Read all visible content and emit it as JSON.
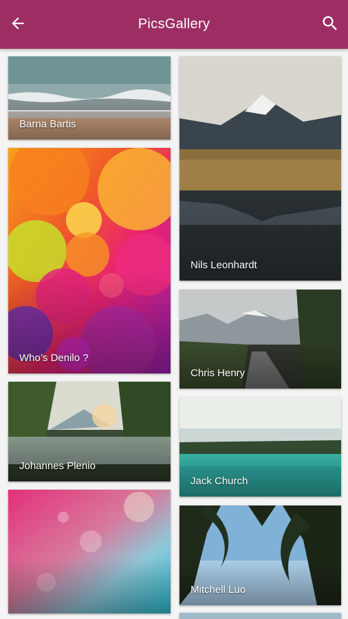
{
  "app": {
    "title": "PicsGallery",
    "accent": "#9c2e63",
    "back_icon": "arrow-left-icon",
    "search_icon": "search-icon"
  },
  "gallery": {
    "photos": [
      {
        "author": "Barna Bartis"
      },
      {
        "author": "Who’s Denilo ?"
      },
      {
        "author": "Johannes Plenio"
      },
      {
        "author": ""
      },
      {
        "author": "Nils Leonhardt"
      },
      {
        "author": "Chris Henry"
      },
      {
        "author": "Jack Church"
      },
      {
        "author": "Mitchell Luo"
      }
    ]
  }
}
